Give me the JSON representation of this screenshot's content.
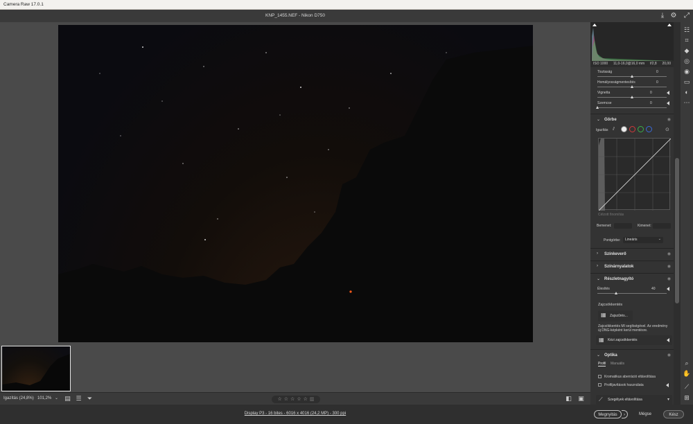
{
  "window": {
    "title": "Camera Raw 17.0.1"
  },
  "file": {
    "name": "KNP_1455.NEF  -  Nikon D750"
  },
  "bottombar": {
    "zoom_label": "Igazítás (24,8%)",
    "zoom_value": "101,2%",
    "stars": [
      "☆",
      "☆",
      "☆",
      "☆",
      "☆"
    ]
  },
  "footer": {
    "info": "Display P3 - 16 bites - 6016 x 4016 (24,2 MP) - 300 ppi",
    "open_label": "Megnyitás",
    "cancel_label": "Mégse",
    "done_label": "Kész"
  },
  "camera_info": {
    "iso": "ISO 1000",
    "lens": "11,0-16,0@16,0 mm",
    "aperture": "f/2,8",
    "shutter": "20,00"
  },
  "sliders": [
    {
      "label": "Tisztaság",
      "value": "0",
      "position": 0.5
    },
    {
      "label": "Homályosságmentesítés",
      "value": "0",
      "position": 0.5
    },
    {
      "label": "Vignetta",
      "value": "0",
      "position": 0.5
    },
    {
      "label": "Szemcse",
      "value": "0",
      "position": 0.0
    }
  ],
  "curve": {
    "section_title": "Görbe",
    "adjust_label": "Igazítás",
    "refine_label": "Célzott finomítás",
    "input_label": "Bemenet:",
    "output_label": "Kimenet:",
    "point_curve_label": "Pontgörbe:",
    "point_curve_value": "Lineáris"
  },
  "sections": {
    "color_mixer": "Színkeverő",
    "color_grading": "Színárnyalatok",
    "detail": "Részletnagyító",
    "optics": "Optika"
  },
  "detail": {
    "sharpening_label": "Élesítés",
    "sharpening_value": "40",
    "sharpening_position": 0.27,
    "noise_reduction_label": "Zajcsökkentés",
    "denoise_button": "Zajszűrés...",
    "denoise_note": "Zajcsökkentés MI segítségével. Az eredmény új DNG-képként kerül mentésre.",
    "manual_noise_button": "Kézi zajcsökkentés"
  },
  "optics": {
    "tabs": [
      "Profil",
      "Manuális"
    ],
    "chromatic_label": "Kromatikus aberráció eltávolítása",
    "profile_label": "Profiljavítások használata",
    "defringe_button": "Szegélyek eltávolítása"
  },
  "colors": {
    "panel": "#333333",
    "workspace": "#4a4a4a",
    "red_channel": "#d23a3a",
    "green_channel": "#3ab04a",
    "blue_channel": "#3a6ad8"
  }
}
